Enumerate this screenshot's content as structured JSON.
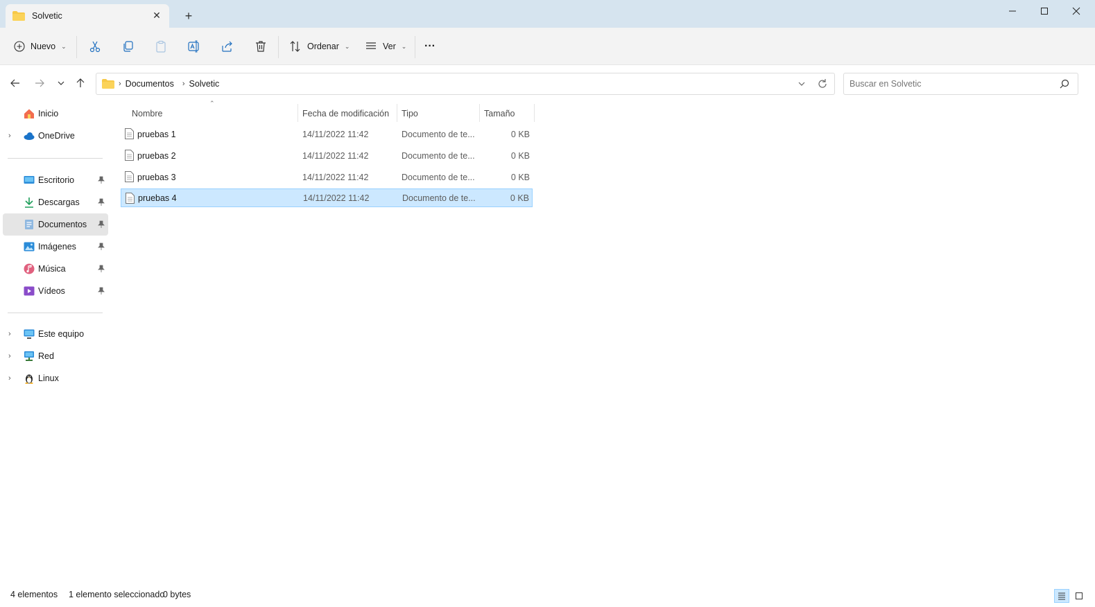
{
  "window": {
    "tab_title": "Solvetic",
    "new_tab_symbol": "+",
    "close_tab_symbol": "✕"
  },
  "toolbar": {
    "new_label": "Nuevo",
    "sort_label": "Ordenar",
    "view_label": "Ver",
    "more_symbol": "···"
  },
  "address": {
    "crumbs": [
      "Documentos",
      "Solvetic"
    ]
  },
  "search": {
    "placeholder": "Buscar en Solvetic"
  },
  "nav": {
    "items": [
      {
        "label": "Inicio",
        "icon": "home-icon"
      },
      {
        "label": "OneDrive",
        "icon": "cloud-icon"
      },
      {
        "label": "Escritorio",
        "icon": "desktop-icon"
      },
      {
        "label": "Descargas",
        "icon": "download-icon"
      },
      {
        "label": "Documentos",
        "icon": "documents-icon"
      },
      {
        "label": "Imágenes",
        "icon": "pictures-icon"
      },
      {
        "label": "Música",
        "icon": "music-icon"
      },
      {
        "label": "Vídeos",
        "icon": "videos-icon"
      },
      {
        "label": "Este equipo",
        "icon": "computer-icon"
      },
      {
        "label": "Red",
        "icon": "network-icon"
      },
      {
        "label": "Linux",
        "icon": "linux-icon"
      }
    ],
    "selected": "Documentos"
  },
  "columns": {
    "name": "Nombre",
    "date": "Fecha de modificación",
    "type": "Tipo",
    "size": "Tamaño"
  },
  "files": [
    {
      "name": "pruebas 1",
      "date": "14/11/2022 11:42",
      "type": "Documento de te...",
      "size": "0 KB"
    },
    {
      "name": "pruebas 2",
      "date": "14/11/2022 11:42",
      "type": "Documento de te...",
      "size": "0 KB"
    },
    {
      "name": "pruebas 3",
      "date": "14/11/2022 11:42",
      "type": "Documento de te...",
      "size": "0 KB"
    },
    {
      "name": "pruebas 4",
      "date": "14/11/2022 11:42",
      "type": "Documento de te...",
      "size": "0 KB"
    }
  ],
  "status": {
    "count": "4 elementos",
    "selection": "1 elemento seleccionado",
    "bytes": "0 bytes"
  },
  "colors": {
    "titlebar": "#d6e4ef",
    "selection": "#cce8ff",
    "folder": "#f7c948",
    "accent": "#0067c0"
  }
}
